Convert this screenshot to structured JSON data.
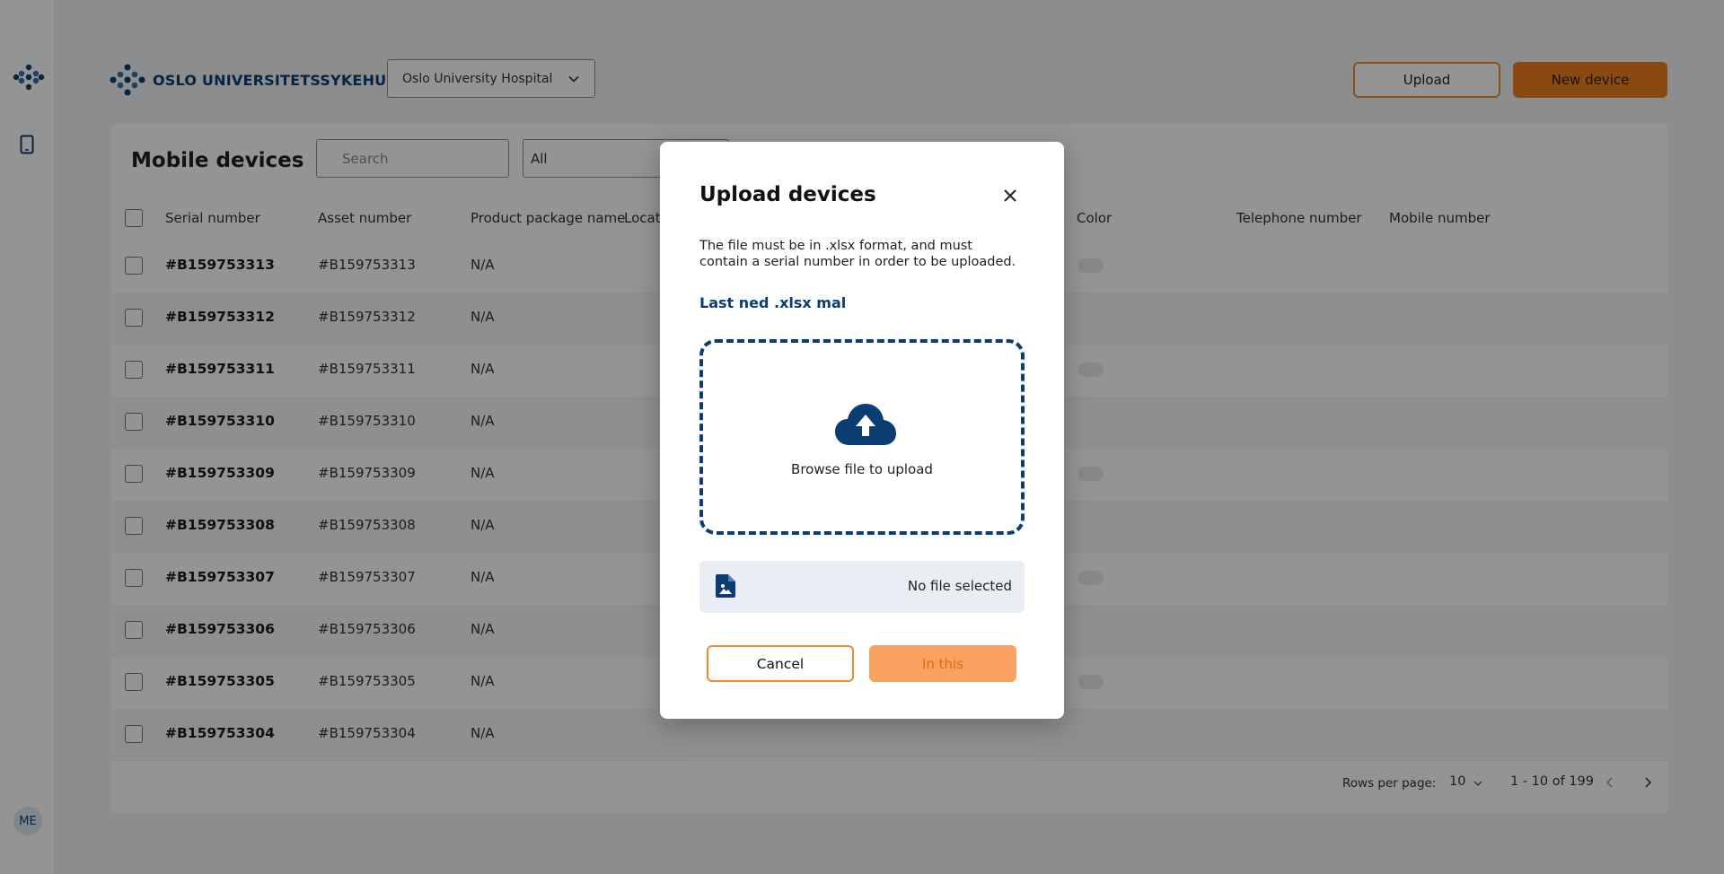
{
  "sidebar": {
    "avatar_initials": "ME",
    "icons": [
      "logo-icon",
      "mobile-device-icon"
    ]
  },
  "header": {
    "brand_name": "OSLO UNIVERSITETSSYKEHUS",
    "org_select_value": "Oslo University Hospital",
    "upload_label": "Upload",
    "new_device_label": "New device"
  },
  "list": {
    "title": "Mobile devices",
    "search_placeholder": "Search",
    "filter_value": "All",
    "columns": [
      "Serial number",
      "Asset number",
      "Product package name",
      "Locat",
      "Color",
      "Telephone number",
      "Mobile number"
    ],
    "rows": [
      {
        "serial": "#B159753313",
        "asset": "#B159753313",
        "package": "N/A"
      },
      {
        "serial": "#B159753312",
        "asset": "#B159753312",
        "package": "N/A"
      },
      {
        "serial": "#B159753311",
        "asset": "#B159753311",
        "package": "N/A"
      },
      {
        "serial": "#B159753310",
        "asset": "#B159753310",
        "package": "N/A"
      },
      {
        "serial": "#B159753309",
        "asset": "#B159753309",
        "package": "N/A"
      },
      {
        "serial": "#B159753308",
        "asset": "#B159753308",
        "package": "N/A"
      },
      {
        "serial": "#B159753307",
        "asset": "#B159753307",
        "package": "N/A"
      },
      {
        "serial": "#B159753306",
        "asset": "#B159753306",
        "package": "N/A"
      },
      {
        "serial": "#B159753305",
        "asset": "#B159753305",
        "package": "N/A"
      },
      {
        "serial": "#B159753304",
        "asset": "#B159753304",
        "package": "N/A"
      }
    ]
  },
  "pagination": {
    "rows_per_page_label": "Rows per page:",
    "rows_per_page_value": "10",
    "range": "1 - 10 of 199"
  },
  "modal": {
    "title": "Upload devices",
    "description": "The file must be in .xlsx format, and must contain a serial number in order to be uploaded.",
    "download_link": "Last ned .xlsx mal",
    "dropzone_text": "Browse file to upload",
    "file_status": "No file selected",
    "cancel_label": "Cancel",
    "submit_label": "In this"
  },
  "colors": {
    "brand_blue": "#0b3d73",
    "accent_orange": "#f07e1f",
    "submit_disabled": "#f9a261"
  }
}
